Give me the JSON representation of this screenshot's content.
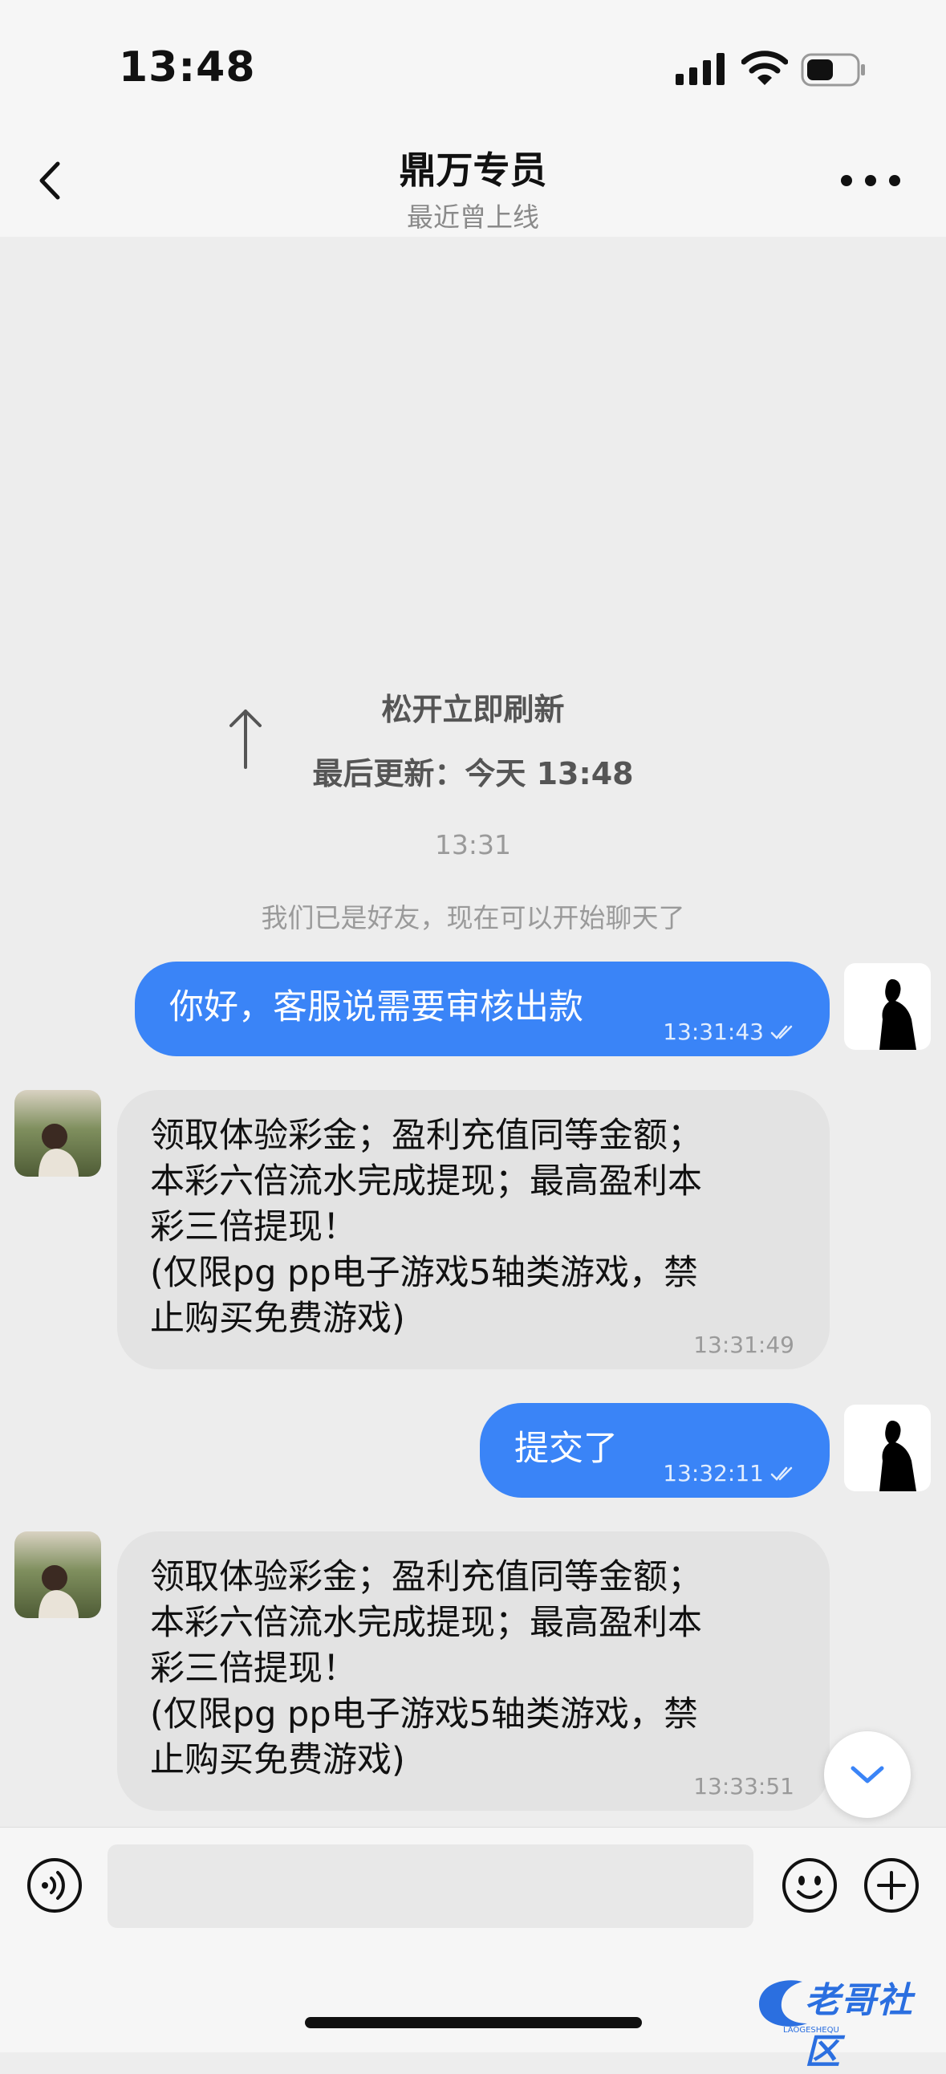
{
  "status_bar": {
    "time": "13:48"
  },
  "header": {
    "title": "鼎万专员",
    "subtitle": "最近曾上线"
  },
  "refresh": {
    "hint": "松开立即刷新",
    "last_update": "最后更新：今天 13:48"
  },
  "divider": {
    "time": "13:31",
    "system_message": "我们已是好友，现在可以开始聊天了"
  },
  "messages": [
    {
      "side": "out",
      "text": "你好，客服说需要审核出款",
      "time": "13:31:43"
    },
    {
      "side": "in",
      "text": "领取体验彩金；盈利充值同等金额；\n本彩六倍流水完成提现；最高盈利本\n彩三倍提现！\n(仅限pg pp电子游戏5轴类游戏，禁\n止购买免费游戏)",
      "time": "13:31:49"
    },
    {
      "side": "out",
      "text": "提交了",
      "time": "13:32:11"
    },
    {
      "side": "in",
      "text": "领取体验彩金；盈利充值同等金额；\n本彩六倍流水完成提现；最高盈利本\n彩三倍提现！\n(仅限pg pp电子游戏5轴类游戏，禁\n止购买免费游戏)",
      "time": "13:33:51"
    }
  ],
  "input": {
    "placeholder": ""
  },
  "watermark": {
    "text": "老哥社区",
    "sub": "LAOGESHEQU"
  },
  "colors": {
    "outgoing_bubble": "#3a84f7",
    "incoming_bubble": "#e3e3e3",
    "background": "#ededed"
  }
}
